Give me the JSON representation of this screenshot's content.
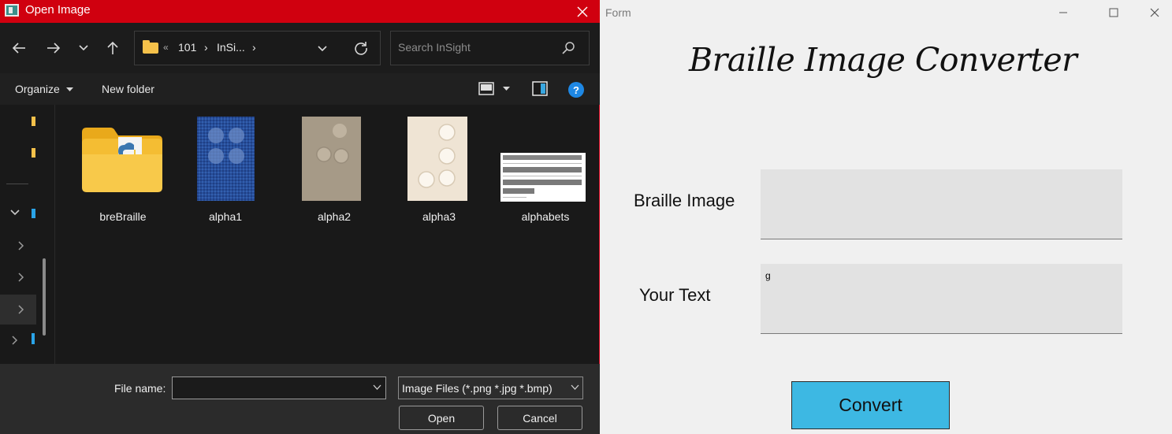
{
  "dialog": {
    "title": "Open Image",
    "breadcrumb": {
      "overflow": "«",
      "segment1": "101",
      "segment2": "InSi...",
      "sep": "›"
    },
    "search": {
      "placeholder": "Search InSight"
    },
    "toolbar": {
      "organize_label": "Organize",
      "new_folder_label": "New folder"
    },
    "files": [
      {
        "name": "breBraille",
        "kind": "folder"
      },
      {
        "name": "alpha1",
        "kind": "image"
      },
      {
        "name": "alpha2",
        "kind": "image"
      },
      {
        "name": "alpha3",
        "kind": "image"
      },
      {
        "name": "alphabets",
        "kind": "image"
      }
    ],
    "file_name_label": "File name:",
    "file_name_value": "",
    "file_type": "Image Files (*.png *.jpg *.bmp)",
    "open_label": "Open",
    "cancel_label": "Cancel"
  },
  "form": {
    "window_title": "Form",
    "heading": "Braille Image Converter",
    "braille_image_label": "Braille Image",
    "your_text_label": "Your Text",
    "your_text_value": "g",
    "convert_label": "Convert"
  },
  "colors": {
    "dialog_titlebar": "#d0000f",
    "convert_button": "#3db8e3",
    "folder_yellow": "#f5c14a"
  }
}
